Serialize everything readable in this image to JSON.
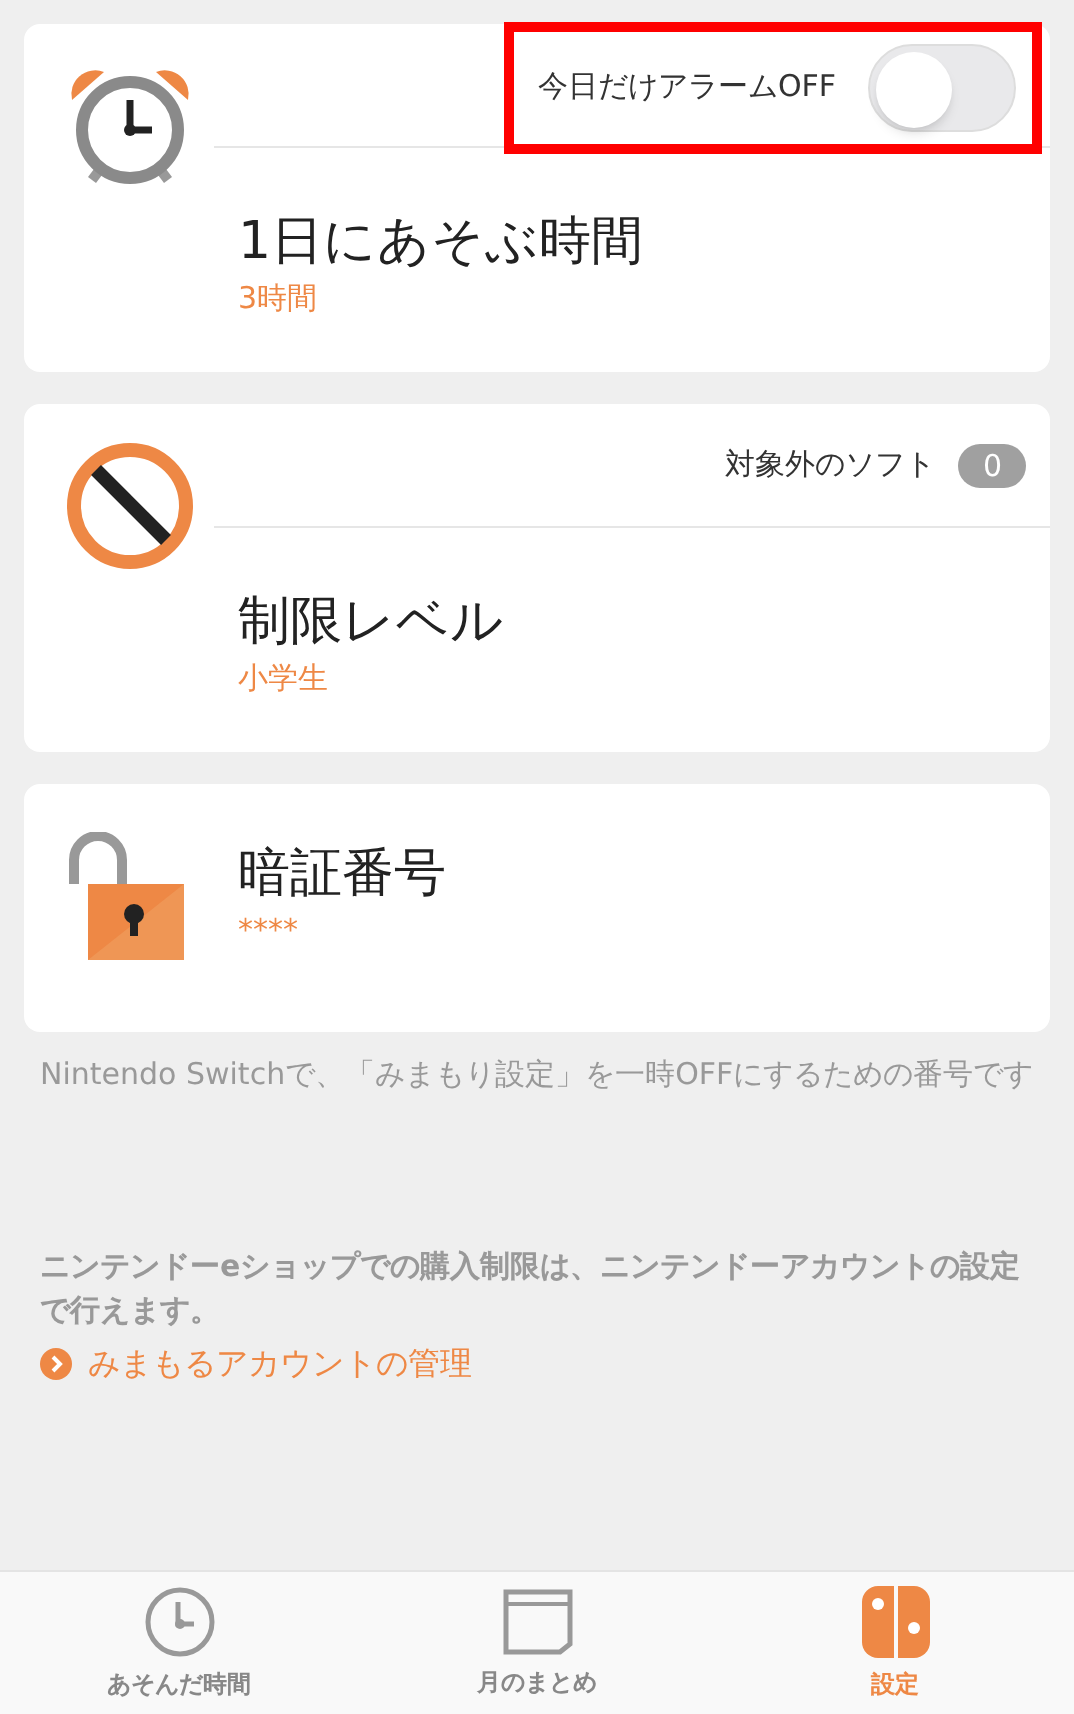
{
  "cards": [
    {
      "kind": "alarm",
      "title": "1日にあそぶ時間",
      "value": "3時間",
      "control": {
        "kind": "toggle",
        "label": "今日だけアラームOFF",
        "on": false,
        "highlighted": true
      }
    },
    {
      "kind": "restriction",
      "title": "制限レベル",
      "value": "小学生",
      "control": {
        "kind": "count",
        "label": "対象外のソフト",
        "count": "0"
      }
    },
    {
      "kind": "pin",
      "title": "暗証番号",
      "value": "****"
    }
  ],
  "pin_note": "Nintendo Switchで、「みまもり設定」を一時OFFにするための番号です",
  "shop_note": "ニンテンドーeショップでの購入制限は、ニンテンドーアカウントの設定で行えます。",
  "account_link": "みまもるアカウントの管理",
  "tabs": [
    {
      "kind": "clock",
      "label": "あそんだ時間",
      "selected": false
    },
    {
      "kind": "calendar",
      "label": "月のまとめ",
      "selected": false
    },
    {
      "kind": "switch",
      "label": "設定",
      "selected": true
    }
  ]
}
